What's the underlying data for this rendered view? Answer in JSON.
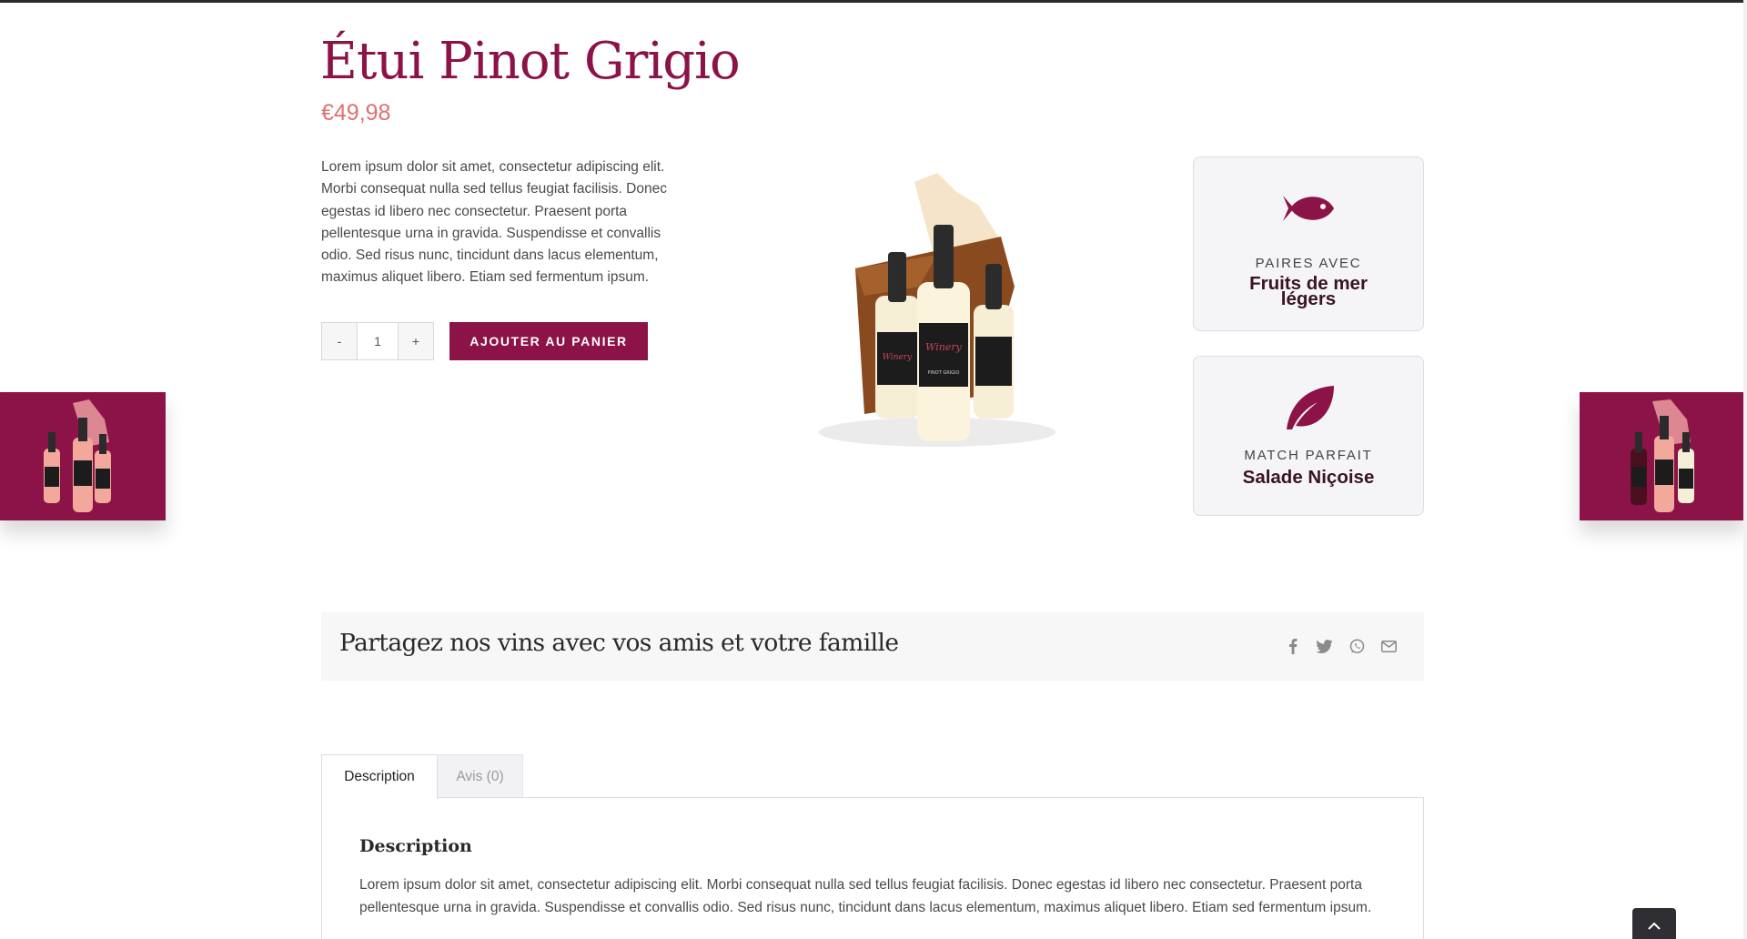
{
  "product": {
    "title": "Étui Pinot Grigio",
    "price": "€49,98",
    "description": "Lorem ipsum dolor sit amet, consectetur adipiscing elit. Morbi consequat nulla sed tellus feugiat facilisis. Donec egestas id libero nec consectetur. Praesent porta pellentesque urna in gravida. Suspendisse et convallis odio. Sed risus nunc, tincidunt dans lacus elementum, maximus aliquet libero. Etiam sed fermentum ipsum.",
    "quantity": "1",
    "qty_minus": "-",
    "qty_plus": "+",
    "add_to_cart": "AJOUTER AU PANIER",
    "image_label": "Winery",
    "image_sublabel": "PINOT GRIGIO"
  },
  "pairings": [
    {
      "kicker": "PAIRES AVEC",
      "value_line1": "Fruits de mer",
      "value_line2": "légers",
      "icon": "fish-icon"
    },
    {
      "kicker": "MATCH PARFAIT",
      "value_line1": "Salade Niçoise",
      "value_line2": "",
      "icon": "leaf-icon"
    }
  ],
  "share": {
    "title": "Partagez nos vins avec vos amis et votre famille",
    "icons": [
      "facebook-icon",
      "twitter-icon",
      "whatsapp-icon",
      "email-icon"
    ]
  },
  "tabs": [
    {
      "label": "Description",
      "active": true
    },
    {
      "label": "Avis (0)",
      "active": false
    }
  ],
  "panel": {
    "title": "Description",
    "text": "Lorem ipsum dolor sit amet, consectetur adipiscing elit. Morbi consequat nulla sed tellus feugiat facilisis. Donec egestas id libero nec consectetur. Praesent porta pellentesque urna in gravida. Suspendisse et convallis odio. Sed risus nunc, tincidunt dans lacus elementum, maximus aliquet libero. Etiam sed fermentum ipsum."
  },
  "colors": {
    "brand": "#8c1347",
    "price": "#e07070",
    "card_bg": "#f5f5f7"
  }
}
